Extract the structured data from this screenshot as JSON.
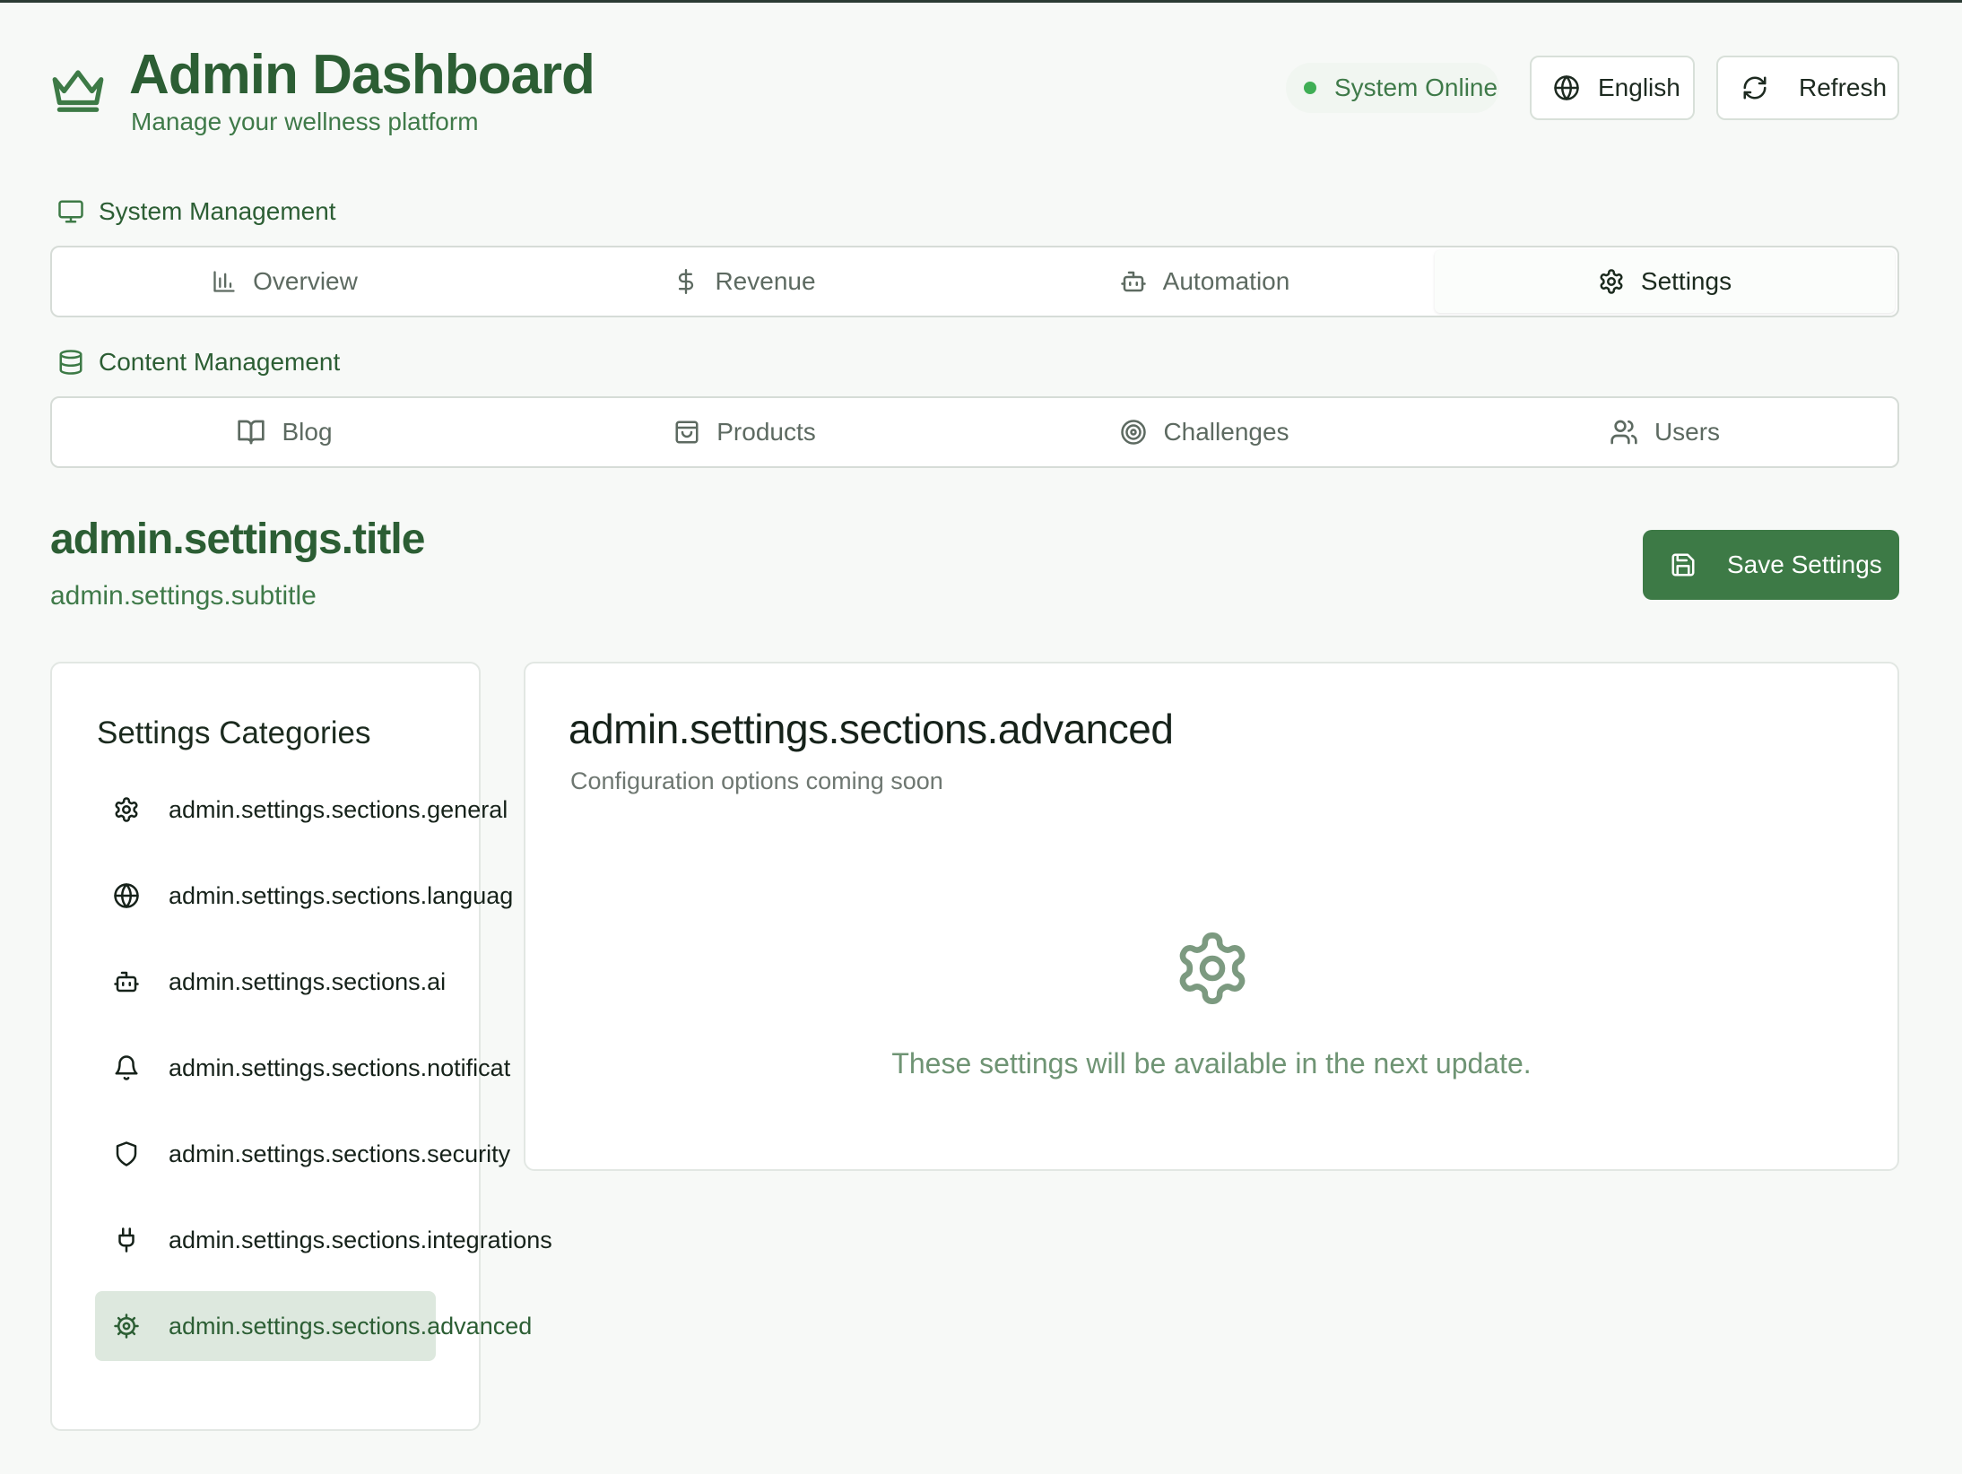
{
  "header": {
    "title": "Admin Dashboard",
    "subtitle": "Manage your wellness platform",
    "status_text": "System Online",
    "language_label": "English",
    "refresh_label": "Refresh"
  },
  "system_management": {
    "label": "System Management",
    "tabs": [
      {
        "label": "Overview",
        "icon": "bar-chart-icon"
      },
      {
        "label": "Revenue",
        "icon": "dollar-icon"
      },
      {
        "label": "Automation",
        "icon": "bot-icon"
      },
      {
        "label": "Settings",
        "icon": "gear-icon",
        "active": true
      }
    ]
  },
  "content_management": {
    "label": "Content Management",
    "tabs": [
      {
        "label": "Blog",
        "icon": "book-icon"
      },
      {
        "label": "Products",
        "icon": "shopping-bag-icon"
      },
      {
        "label": "Challenges",
        "icon": "target-icon"
      },
      {
        "label": "Users",
        "icon": "users-icon"
      }
    ]
  },
  "page": {
    "title": "admin.settings.title",
    "subtitle": "admin.settings.subtitle",
    "save_label": "Save Settings"
  },
  "categories": {
    "title": "Settings Categories",
    "items": [
      {
        "label": "admin.settings.sections.general",
        "icon": "gear-icon"
      },
      {
        "label": "admin.settings.sections.languag",
        "icon": "globe-icon"
      },
      {
        "label": "admin.settings.sections.ai",
        "icon": "bot-icon"
      },
      {
        "label": "admin.settings.sections.notificat",
        "icon": "bell-icon"
      },
      {
        "label": "admin.settings.sections.security",
        "icon": "shield-icon"
      },
      {
        "label": "admin.settings.sections.integrations",
        "icon": "plug-icon"
      },
      {
        "label": "admin.settings.sections.advanced",
        "icon": "cog-icon",
        "active": true
      }
    ]
  },
  "content": {
    "title": "admin.settings.sections.advanced",
    "subtitle": "Configuration options coming soon",
    "message": "These settings will be available in the next update.",
    "icon": "gear-icon"
  },
  "colors": {
    "brand_green": "#2c5e34",
    "button_green": "#3d7a46",
    "status_dot": "#3fae55",
    "active_item_bg": "#dde8de"
  }
}
